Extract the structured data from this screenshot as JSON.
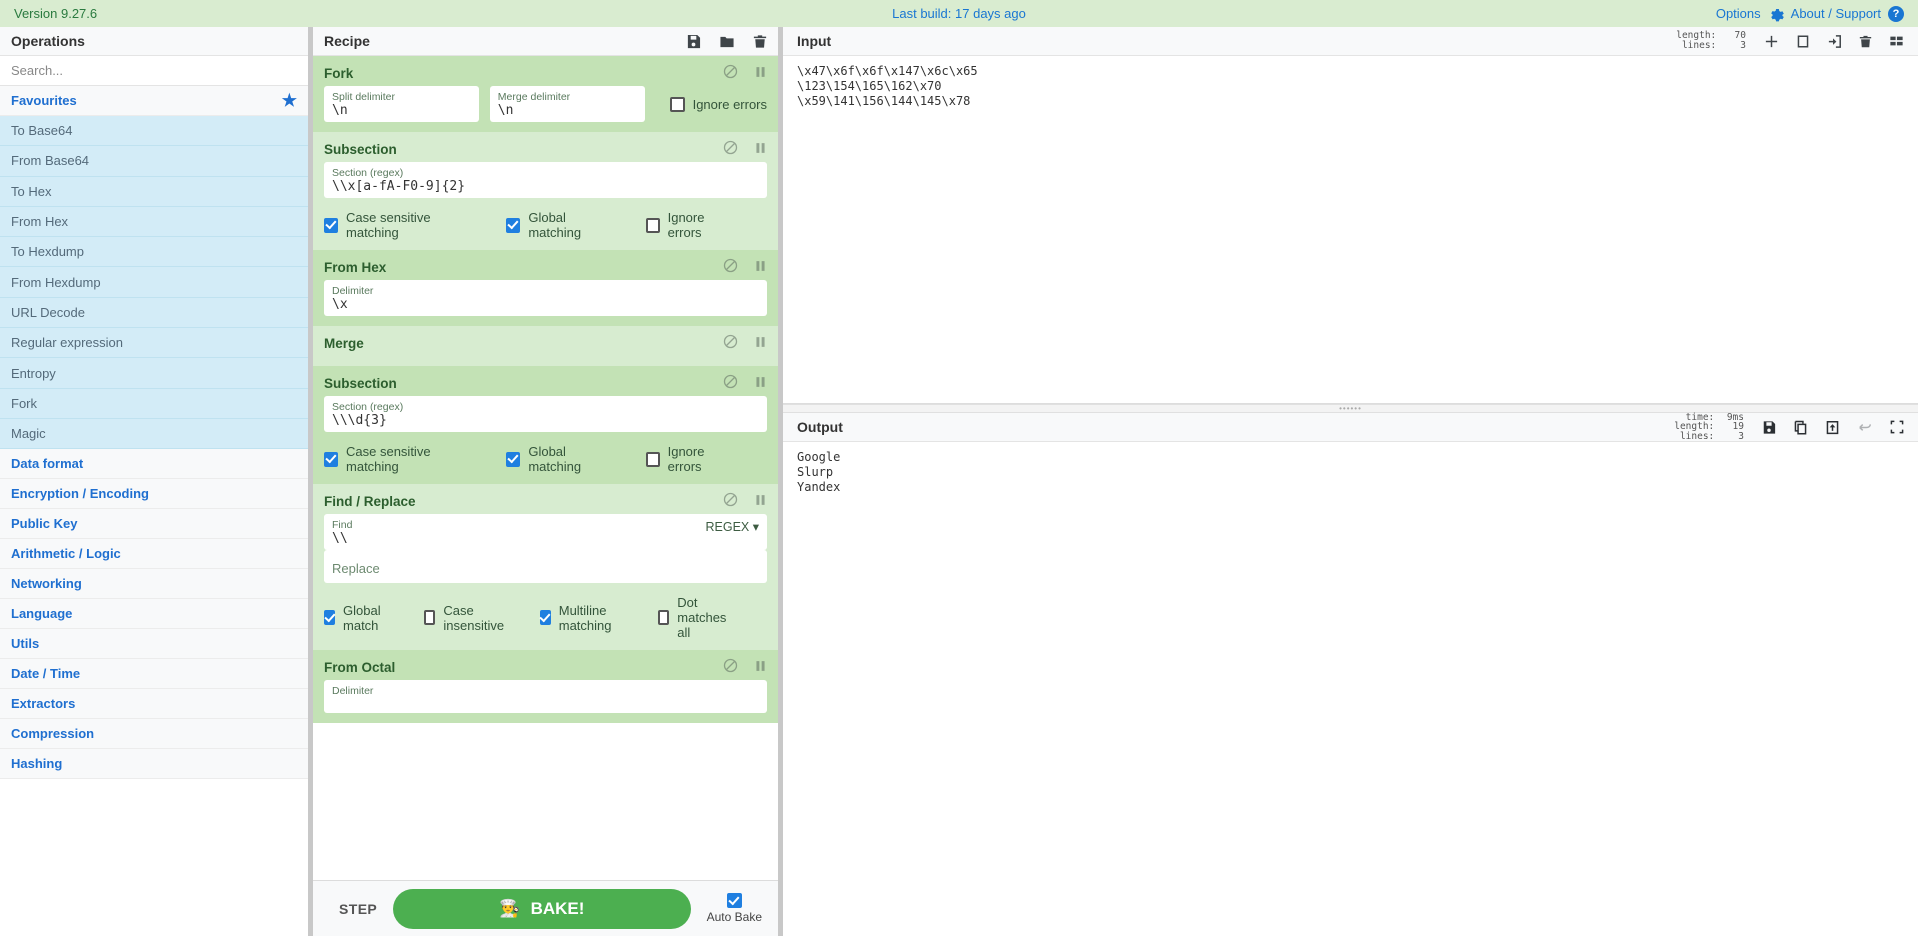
{
  "banner": {
    "version": "Version 9.27.6",
    "last_build": "Last build: 17 days ago",
    "options": "Options",
    "about": "About / Support"
  },
  "operations": {
    "title": "Operations",
    "search_placeholder": "Search...",
    "favourites_label": "Favourites",
    "favourites": [
      "To Base64",
      "From Base64",
      "To Hex",
      "From Hex",
      "To Hexdump",
      "From Hexdump",
      "URL Decode",
      "Regular expression",
      "Entropy",
      "Fork",
      "Magic"
    ],
    "categories": [
      "Data format",
      "Encryption / Encoding",
      "Public Key",
      "Arithmetic / Logic",
      "Networking",
      "Language",
      "Utils",
      "Date / Time",
      "Extractors",
      "Compression",
      "Hashing"
    ]
  },
  "recipe": {
    "title": "Recipe",
    "operations": [
      {
        "name": "Fork",
        "args": [
          {
            "label": "Split delimiter",
            "value": "\\n"
          },
          {
            "label": "Merge delimiter",
            "value": "\\n"
          }
        ],
        "checkboxes": [
          {
            "label": "Ignore errors",
            "checked": false
          }
        ]
      },
      {
        "name": "Subsection",
        "args": [
          {
            "label": "Section (regex)",
            "value": "\\\\x[a-fA-F0-9]{2}"
          }
        ],
        "checkboxes": [
          {
            "label": "Case sensitive matching",
            "checked": true
          },
          {
            "label": "Global matching",
            "checked": true
          },
          {
            "label": "Ignore errors",
            "checked": false
          }
        ]
      },
      {
        "name": "From Hex",
        "args": [
          {
            "label": "Delimiter",
            "value": "\\x"
          }
        ],
        "checkboxes": []
      },
      {
        "name": "Merge",
        "args": [],
        "checkboxes": []
      },
      {
        "name": "Subsection",
        "args": [
          {
            "label": "Section (regex)",
            "value": "\\\\\\d{3}"
          }
        ],
        "checkboxes": [
          {
            "label": "Case sensitive matching",
            "checked": true
          },
          {
            "label": "Global matching",
            "checked": true
          },
          {
            "label": "Ignore errors",
            "checked": false
          }
        ]
      },
      {
        "name": "Find / Replace",
        "args": [
          {
            "label": "Find",
            "value": "\\\\",
            "dropdown": "REGEX"
          },
          {
            "label": "",
            "placeholder": "Replace",
            "value": ""
          }
        ],
        "checkboxes": [
          {
            "label": "Global match",
            "checked": true
          },
          {
            "label": "Case insensitive",
            "checked": false
          },
          {
            "label": "Multiline matching",
            "checked": true
          },
          {
            "label": "Dot matches all",
            "checked": false
          }
        ]
      },
      {
        "name": "From Octal",
        "args": [
          {
            "label": "Delimiter",
            "value": ""
          }
        ],
        "checkboxes": []
      }
    ],
    "bake": {
      "step_label": "STEP",
      "bake_label": "BAKE!",
      "chef_icon": "chef-emoji",
      "auto_bake_label": "Auto Bake",
      "auto_bake_checked": true
    }
  },
  "input": {
    "title": "Input",
    "meta": [
      {
        "key": "length:",
        "value": "70"
      },
      {
        "key": "lines:",
        "value": "3"
      }
    ],
    "lines": [
      "\\x47\\x6f\\x6f\\x147\\x6c\\x65",
      "\\123\\154\\165\\162\\x70",
      "\\x59\\141\\156\\144\\145\\x78"
    ]
  },
  "output": {
    "title": "Output",
    "meta": [
      {
        "key": "time:",
        "value": "9ms"
      },
      {
        "key": "length:",
        "value": "19"
      },
      {
        "key": "lines:",
        "value": "3"
      }
    ],
    "lines": [
      "Google",
      "Slurp",
      "Yandex"
    ]
  },
  "colors": {
    "banner_bg": "#d9ecd0",
    "link": "#1976d2",
    "op_shade_a": "#c3e2b5",
    "op_shade_b": "#d7ecd0",
    "bake_green": "#4caf50",
    "fav_item_bg": "#d3ecf7"
  }
}
